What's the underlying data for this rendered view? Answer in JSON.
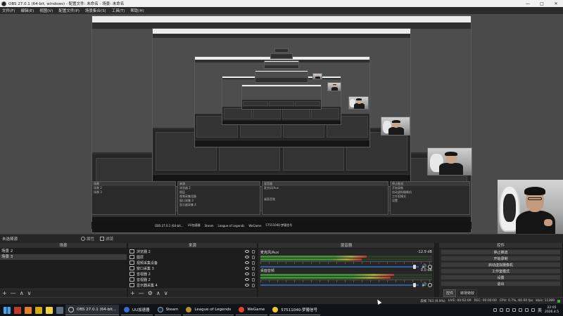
{
  "window": {
    "title": "OBS 27.0.1 (64-bit, windows) - 配置文件: 未命名 - 场景: 未命名",
    "controls": [
      "—",
      "□",
      "✕"
    ]
  },
  "menu": [
    "文件(F)",
    "编辑(E)",
    "视图(V)",
    "配置文件(P)",
    "场景集合(S)",
    "工具(T)",
    "帮助(H)"
  ],
  "preview_nested": {
    "title": "OBS 27.0.1 (64-bit, windows) - 配置文件: 未命名 - 场景: 未命名",
    "scenes_label": "场景",
    "sources_label": "来源",
    "mixer_label": "混音器",
    "scene_items": [
      "场景 2",
      "场景 3"
    ],
    "source_items": [
      "浏览器 2",
      "图层",
      "视频采集设备",
      "窗口采集 3",
      "音视器 2",
      "音视器 2",
      "显示器采集 4"
    ],
    "mixer_items": [
      "麦克风/Aux",
      "桌面音频"
    ],
    "controls": [
      "停止推流",
      "开始录制",
      "启动虚拟摄像机",
      "工作室模式",
      "设置",
      "退出"
    ],
    "taskbar": [
      "OBS 27.0.1 (64-bit...",
      "UU加速器",
      "Steam",
      "League of Legends",
      "WeGame",
      "57511040-梦魇信号"
    ]
  },
  "docks_header": {
    "label": "未选择源",
    "properties": "属性",
    "filters": "滤镜"
  },
  "scenes": {
    "title": "场景",
    "items": [
      {
        "label": "场景 2",
        "selected": false
      },
      {
        "label": "场景 3",
        "selected": true
      }
    ],
    "footer": [
      "+",
      "—",
      "∧",
      "∨"
    ]
  },
  "sources": {
    "title": "来源",
    "items": [
      {
        "label": "浏览器 2",
        "icon": "browser-icon"
      },
      {
        "label": "图层",
        "icon": "image-icon"
      },
      {
        "label": "视频采集设备",
        "icon": "camera-icon"
      },
      {
        "label": "窗口采集 3",
        "icon": "window-icon"
      },
      {
        "label": "音视器 2",
        "icon": "audio-icon"
      },
      {
        "label": "音视器 2",
        "icon": "audio-icon"
      },
      {
        "label": "显示器采集 4",
        "icon": "monitor-icon"
      }
    ],
    "footer": [
      "+",
      "—",
      "⚙",
      "∧",
      "∨"
    ]
  },
  "mixer": {
    "title": "混音器",
    "channels": [
      {
        "name": "麦克风/Aux",
        "db": "-12.9 dB",
        "level": 0.62
      },
      {
        "name": "桌面音频",
        "db": "0.0 dB",
        "level": 0.78
      }
    ]
  },
  "controls": {
    "title": "控件",
    "buttons": [
      "停止推流",
      "开始录制",
      "启动虚拟摄像机",
      "工作室模式",
      "设置",
      "退出"
    ],
    "tabs": [
      "控件",
      "转场特效"
    ]
  },
  "status": {
    "dropped": "丢帧 763 (9.9%)",
    "live": "LIVE: 00:02:09",
    "rec": "REC: 00:00:00",
    "cpu": "CPU: 0.7%, 60.00 fps",
    "kbps": "kb/s: 11389"
  },
  "taskbar": {
    "apps": [
      {
        "label": "OBS 27.0.1 (64-bit...",
        "color": "#2b2b2b",
        "active": true
      },
      {
        "label": "UU加速器",
        "color": "#2f6fd6",
        "active": false
      },
      {
        "label": "Steam",
        "color": "#1b2838",
        "active": false
      },
      {
        "label": "League of Legends",
        "color": "#b8912f",
        "active": false
      },
      {
        "label": "WeGame",
        "color": "#e0452c",
        "active": false
      },
      {
        "label": "57511040-梦魇信号",
        "color": "#f1c232",
        "active": false
      }
    ],
    "ime": "英",
    "time": "22:05",
    "date": "2026.4.5"
  },
  "colors": {
    "accent": "#2d5fa3",
    "meter_green": "#3f8f34",
    "meter_yellow": "#a6a632",
    "meter_red": "#b23232",
    "status_ok": "#3cae3c"
  }
}
